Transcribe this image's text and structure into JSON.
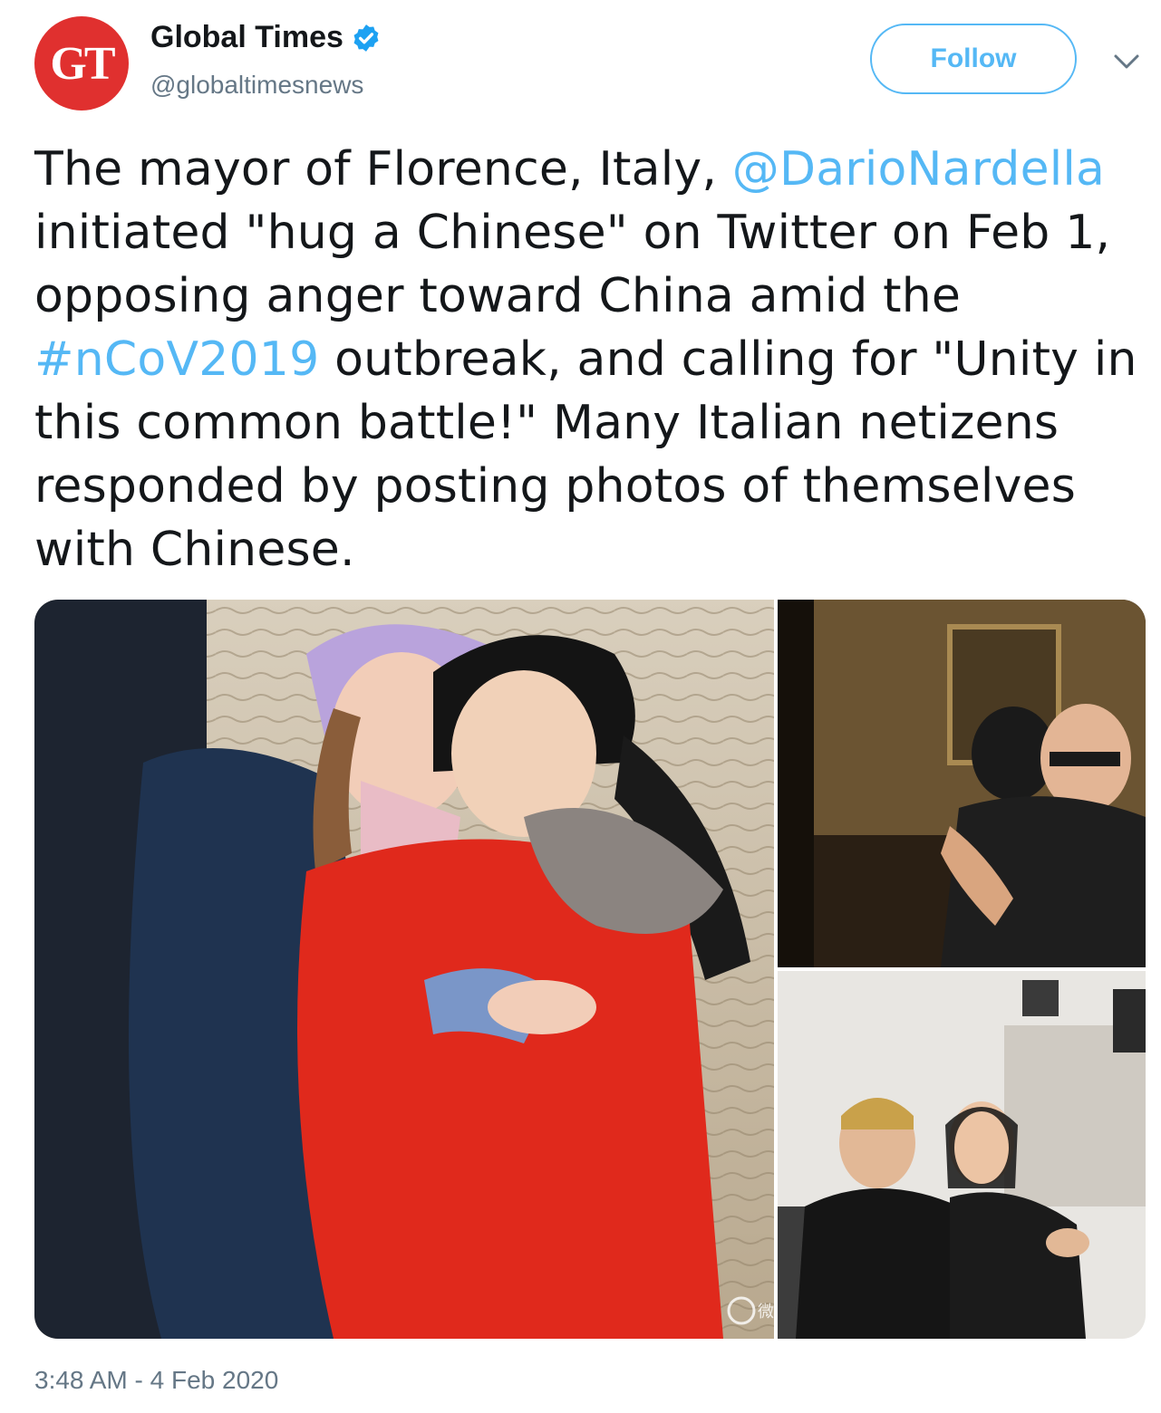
{
  "author": {
    "avatar_text": "GT",
    "display_name": "Global Times",
    "handle": "@globaltimesnews",
    "verified": true
  },
  "actions": {
    "follow_label": "Follow",
    "more_icon": "chevron-down-icon"
  },
  "tweet": {
    "text_part1": "The mayor of Florence, Italy, ",
    "mention": "@DarioNardella",
    "text_part2": " initiated \"hug a Chinese\" on Twitter on Feb 1, opposing anger toward China amid the ",
    "hashtag": "#nCoV2019",
    "text_part3": " outbreak, and calling for \"Unity in this common battle!\" Many Italian netizens responded by posting photos of themselves with Chinese."
  },
  "media": {
    "photos": [
      "photo-children-hugging",
      "photo-mayor-hug",
      "photo-couple-hug"
    ],
    "watermark_text": "微博"
  },
  "timestamp": "3:48 AM - 4 Feb 2020",
  "colors": {
    "link": "#1da1f2",
    "avatar_bg": "#e0302f",
    "secondary_text": "#657786"
  }
}
